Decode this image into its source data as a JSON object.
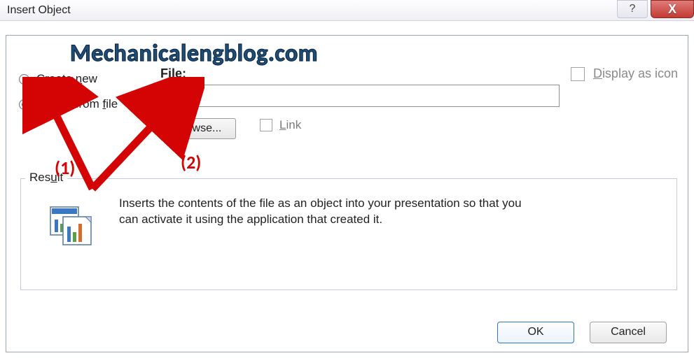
{
  "titlebar": {
    "title": "Insert Object",
    "help_glyph": "?",
    "close_glyph": "X"
  },
  "watermark": "Mechanicalengblog.com",
  "radios": {
    "create_new": "Create new",
    "create_new_ul": "n",
    "create_from_file_pre": "Create from ",
    "create_from_file_ul": "f",
    "create_from_file_post": "ile",
    "selected": "create_from_file"
  },
  "file": {
    "label": "File:",
    "value": "",
    "browse_pre": "",
    "browse_ul": "B",
    "browse_post": "rowse..."
  },
  "link": {
    "label_ul": "L",
    "label_post": "ink"
  },
  "display_as_icon": {
    "label_ul": "D",
    "label_post": "isplay as icon"
  },
  "result": {
    "legend_pre": "Res",
    "legend_ul": "u",
    "legend_post": "lt",
    "text": "Inserts the contents of the file as an object into your presentation so that you can activate it using the application that created it."
  },
  "buttons": {
    "ok": "OK",
    "cancel": "Cancel"
  },
  "annotations": {
    "a1": "(1)",
    "a2": "(2)"
  }
}
